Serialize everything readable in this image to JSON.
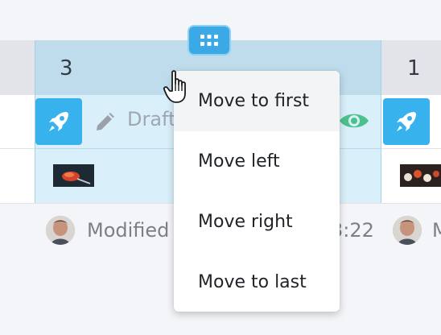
{
  "header": {
    "selected_column_number": "3",
    "next_column_number": "1"
  },
  "row1": {
    "status_label": "Draft"
  },
  "row3": {
    "modified_label_1": "Modified",
    "time_fragment": "3:22",
    "modified_label_2": "M"
  },
  "context_menu": {
    "items": [
      {
        "label": "Move to first",
        "highlighted": true
      },
      {
        "label": "Move left",
        "highlighted": false
      },
      {
        "label": "Move right",
        "highlighted": false
      },
      {
        "label": "Move to last",
        "highlighted": false
      }
    ]
  },
  "icons": {
    "drag_handle": "grid-dots-icon",
    "publish": "rocket-icon",
    "edit": "pencil-icon",
    "preview": "eye-icon",
    "cursor": "hand-pointer-icon"
  },
  "colors": {
    "accent": "#38b2ec",
    "selected_header": "#bfdcec",
    "selected_body": "#d9eff9",
    "eye_green": "#4cc18b"
  }
}
